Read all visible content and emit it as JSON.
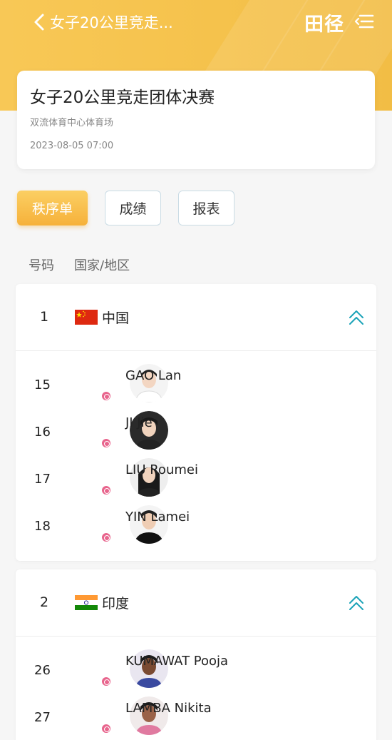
{
  "header": {
    "title": "女子20公里竞走...",
    "sport": "田径",
    "back_icon": "chevron-left-icon",
    "menu_icon": "menu-icon"
  },
  "event": {
    "title": "女子20公里竞走团体决赛",
    "venue": "双流体育中心体育场",
    "datetime": "2023-08-05 07:00"
  },
  "tabs": [
    {
      "label": "秩序单",
      "active": true
    },
    {
      "label": "成绩",
      "active": false
    },
    {
      "label": "报表",
      "active": false
    }
  ],
  "columns": {
    "number": "号码",
    "country": "国家/地区"
  },
  "teams": [
    {
      "rank": "1",
      "country": "中国",
      "flag": "china-flag",
      "athletes": [
        {
          "bib": "15",
          "name": "GAO Lan"
        },
        {
          "bib": "16",
          "name": "JI Jie"
        },
        {
          "bib": "17",
          "name": "LIU Roumei"
        },
        {
          "bib": "18",
          "name": "YIN Lamei"
        }
      ]
    },
    {
      "rank": "2",
      "country": "印度",
      "flag": "india-flag",
      "athletes": [
        {
          "bib": "26",
          "name": "KUMAWAT Pooja"
        },
        {
          "bib": "27",
          "name": "LAMBA Nikita"
        }
      ]
    }
  ],
  "colors": {
    "accent": "#f6b13a",
    "header": "#f5c24c",
    "chevron": "#1ba3b8",
    "badge": "#e8658d"
  }
}
